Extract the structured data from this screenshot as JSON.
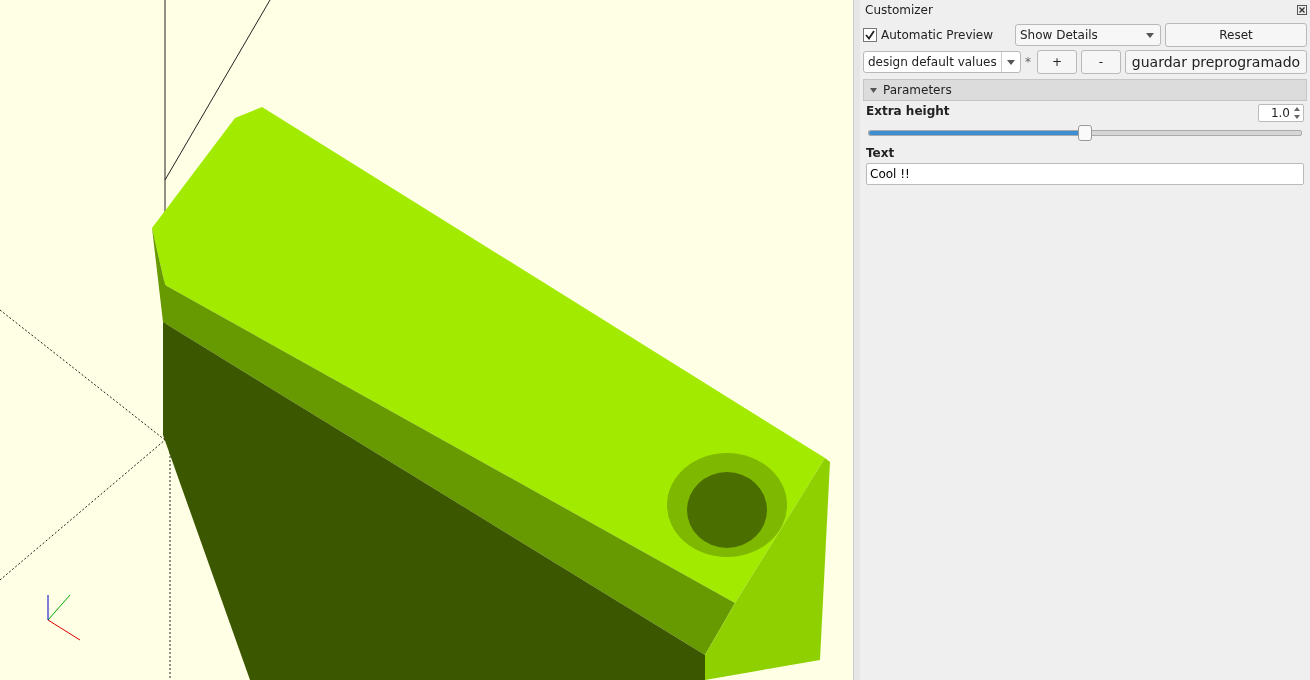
{
  "customizer": {
    "title": "Customizer",
    "automatic_preview": {
      "label": "Automatic Preview",
      "checked": true
    },
    "details_dropdown": {
      "value": "Show Details"
    },
    "reset_button": "Reset",
    "preset_dropdown": {
      "value": "design default values",
      "modified_mark": "*"
    },
    "add_button": "+",
    "remove_button": "-",
    "save_preset_button": "guardar preprogramado",
    "section": {
      "label": "Parameters",
      "expanded": true,
      "parameters": [
        {
          "kind": "slider",
          "label": "Extra height",
          "value": "1.0",
          "level": 0.5
        },
        {
          "kind": "text",
          "label": "Text",
          "value": "Cool !!"
        }
      ]
    }
  }
}
